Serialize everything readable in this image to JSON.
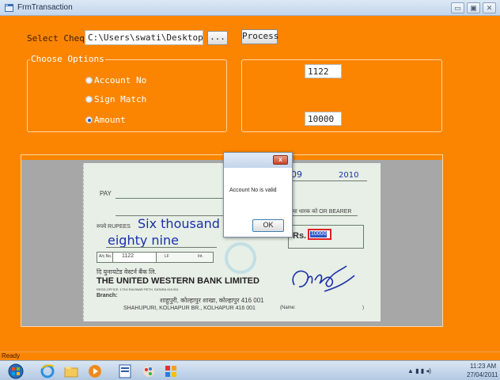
{
  "window": {
    "title": "FrmTransaction",
    "min_glyph": "▭",
    "max_glyph": "▣",
    "close_glyph": "✕"
  },
  "form": {
    "select_cheque_label": "Select Cheque",
    "cheque_path": "C:\\Users\\swati\\Desktop\\aa.",
    "browse_label": "...",
    "process_label": "Process",
    "choose_options_label": "Choose Options",
    "options": [
      {
        "label": "Account No",
        "selected": false
      },
      {
        "label": "Sign Match",
        "selected": false
      },
      {
        "label": "Amount",
        "selected": true
      }
    ],
    "account_no_value": "1122",
    "amount_value": "10000"
  },
  "cheque": {
    "date_day": "09",
    "date_year": "2010",
    "pay_label": "PAY",
    "bearer_label": "या धारक को OR BEARER",
    "rupees_label": "रुपये RUPEES",
    "amount_words_line1": "Six thousand se",
    "amount_words_line2": "eighty nine",
    "rs_label": "Rs.",
    "rs_box_value": "10000",
    "acno_label": "A/c.No.",
    "acno_value": "1122",
    "lf_label": "LF",
    "int_label": "Int.",
    "hindi_bank": "दि युनायटेड वेस्टर्न बैंक लि.",
    "bank_name": "THE UNITED WESTERN BANK LIMITED",
    "regd_office": "REGD.OFFICE: 172/4 RAVIWAR PETH, SATARA 415 001",
    "branch_label": "Branch:",
    "branch_hindi": "शाहुपुरी, कोल्हापुर शाखा, कोल्हापुर 416 001",
    "branch_en": "SHAHUPURI, KOLHAPUR BR., KOLHAPUR 416 001",
    "name_label": "(Name:",
    "name_close": ")"
  },
  "dialog": {
    "message": "Account No is valid",
    "ok_label": "OK",
    "close_glyph": "x"
  },
  "status": {
    "text": "Ready"
  },
  "taskbar": {
    "time": "11:23 AM",
    "date": "27/04/2011"
  }
}
